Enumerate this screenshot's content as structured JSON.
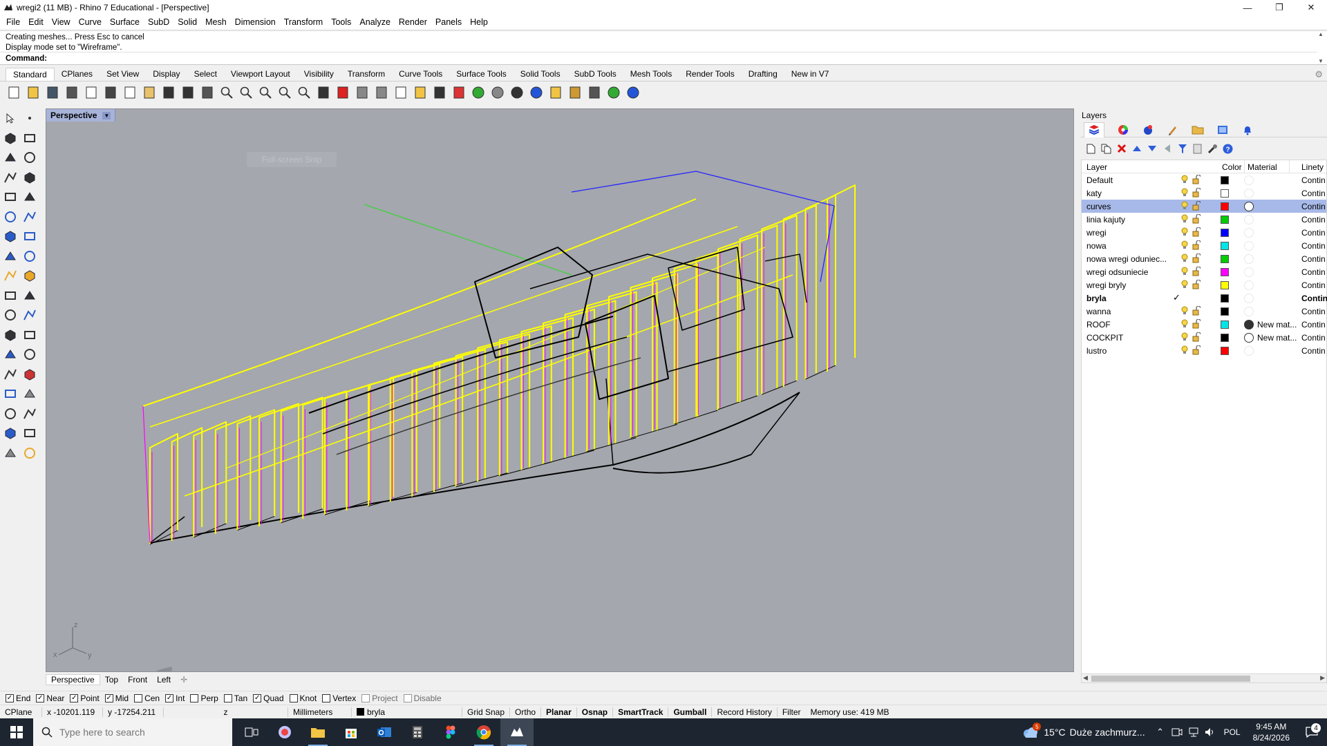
{
  "window": {
    "title": "wregi2 (11 MB) - Rhino 7 Educational - [Perspective]",
    "minimize": "—",
    "maximize": "❐",
    "close": "✕"
  },
  "menu": [
    "File",
    "Edit",
    "View",
    "Curve",
    "Surface",
    "SubD",
    "Solid",
    "Mesh",
    "Dimension",
    "Transform",
    "Tools",
    "Analyze",
    "Render",
    "Panels",
    "Help"
  ],
  "command": {
    "history": [
      "Creating meshes... Press Esc to cancel",
      "Display mode set to \"Wireframe\"."
    ],
    "prompt_label": "Command:",
    "input_value": ""
  },
  "toolbar_tabs": [
    "Standard",
    "CPlanes",
    "Set View",
    "Display",
    "Select",
    "Viewport Layout",
    "Visibility",
    "Transform",
    "Curve Tools",
    "Surface Tools",
    "Solid Tools",
    "SubD Tools",
    "Mesh Tools",
    "Render Tools",
    "Drafting",
    "New in V7"
  ],
  "toolbar_icons": [
    "new-icon",
    "open-icon",
    "save-icon",
    "print-icon",
    "import-icon",
    "cut-icon",
    "copy-icon",
    "paste-icon",
    "undo-icon",
    "pan-icon",
    "rotate-icon",
    "zoom-icon",
    "zoom-window-icon",
    "zoom-extents-icon",
    "zoom-selected-icon",
    "zoom-all-icon",
    "four-views-icon",
    "car-icon",
    "cplane-icon",
    "grid-icon",
    "properties-icon",
    "light-icon",
    "lock-icon",
    "material-icon",
    "color-wheel-icon",
    "shaded-icon",
    "rendered-icon",
    "sphere-icon",
    "filter-icon",
    "settings-icon",
    "dimension-icon",
    "globe-icon",
    "help-icon"
  ],
  "viewport": {
    "label": "Perspective",
    "snip_hint": "Full-screen Snip",
    "axis_z": "z",
    "axis_x": "x",
    "axis_y": "y"
  },
  "viewport_tabs": [
    "Perspective",
    "Top",
    "Front",
    "Left"
  ],
  "layers_panel": {
    "title": "Layers",
    "columns": {
      "layer": "Layer",
      "color": "Color",
      "material": "Material",
      "linetype": "Linety"
    },
    "rows": [
      {
        "name": "Default",
        "color": "#000000",
        "material": "",
        "material_swatch": "",
        "linetype": "Contin",
        "current": false,
        "selected": false
      },
      {
        "name": "katy",
        "color": "#ffffff",
        "material": "",
        "material_swatch": "",
        "linetype": "Contin",
        "current": false,
        "selected": false
      },
      {
        "name": "curves",
        "color": "#ff0000",
        "material": "",
        "material_swatch": "#ffffff",
        "linetype": "Contin",
        "current": false,
        "selected": true
      },
      {
        "name": "linia kajuty",
        "color": "#00cc00",
        "material": "",
        "material_swatch": "",
        "linetype": "Contin",
        "current": false,
        "selected": false
      },
      {
        "name": "wregi",
        "color": "#0000ff",
        "material": "",
        "material_swatch": "",
        "linetype": "Contin",
        "current": false,
        "selected": false
      },
      {
        "name": "nowa",
        "color": "#00e5e5",
        "material": "",
        "material_swatch": "",
        "linetype": "Contin",
        "current": false,
        "selected": false
      },
      {
        "name": "nowa wregi oduniec...",
        "color": "#00cc00",
        "material": "",
        "material_swatch": "",
        "linetype": "Contin",
        "current": false,
        "selected": false
      },
      {
        "name": "wregi odsuniecie",
        "color": "#ff00ff",
        "material": "",
        "material_swatch": "",
        "linetype": "Contin",
        "current": false,
        "selected": false
      },
      {
        "name": "wregi bryly",
        "color": "#ffff00",
        "material": "",
        "material_swatch": "",
        "linetype": "Contin",
        "current": false,
        "selected": false
      },
      {
        "name": "bryla",
        "color": "#000000",
        "material": "",
        "material_swatch": "",
        "linetype": "Contin",
        "current": true,
        "selected": false
      },
      {
        "name": "wanna",
        "color": "#000000",
        "material": "",
        "material_swatch": "",
        "linetype": "Contin",
        "current": false,
        "selected": false
      },
      {
        "name": "ROOF",
        "color": "#00e5e5",
        "material": "New mat...",
        "material_swatch": "#333333",
        "linetype": "Contin",
        "current": false,
        "selected": false
      },
      {
        "name": "COCKPIT",
        "color": "#000000",
        "material": "New mat...",
        "material_swatch": "#ffffff",
        "linetype": "Contin",
        "current": false,
        "selected": false
      },
      {
        "name": "lustro",
        "color": "#ff0000",
        "material": "",
        "material_swatch": "",
        "linetype": "Contin",
        "current": false,
        "selected": false
      }
    ]
  },
  "osnaps": [
    {
      "label": "End",
      "checked": true
    },
    {
      "label": "Near",
      "checked": true
    },
    {
      "label": "Point",
      "checked": true
    },
    {
      "label": "Mid",
      "checked": true
    },
    {
      "label": "Cen",
      "checked": false
    },
    {
      "label": "Int",
      "checked": true
    },
    {
      "label": "Perp",
      "checked": false
    },
    {
      "label": "Tan",
      "checked": false
    },
    {
      "label": "Quad",
      "checked": true
    },
    {
      "label": "Knot",
      "checked": false
    },
    {
      "label": "Vertex",
      "checked": false
    },
    {
      "label": "Project",
      "checked": false,
      "disabled": true
    },
    {
      "label": "Disable",
      "checked": false,
      "disabled": true
    }
  ],
  "status": {
    "cplane": "CPlane",
    "x": "x -10201.119",
    "y": "y -17254.211",
    "z": "z",
    "units": "Millimeters",
    "layer": "bryla",
    "toggles": [
      {
        "label": "Grid Snap",
        "bold": false
      },
      {
        "label": "Ortho",
        "bold": false
      },
      {
        "label": "Planar",
        "bold": true
      },
      {
        "label": "Osnap",
        "bold": true
      },
      {
        "label": "SmartTrack",
        "bold": true
      },
      {
        "label": "Gumball",
        "bold": true
      },
      {
        "label": "Record History",
        "bold": false
      },
      {
        "label": "Filter",
        "bold": false
      }
    ],
    "memory": "Memory use: 419 MB"
  },
  "taskbar": {
    "search_placeholder": "Type here to search",
    "weather_temp": "15°C",
    "weather_desc": "Duże zachmurz...",
    "lang": "POL",
    "time": "9:45 AM",
    "date": "8/24/2026",
    "notif_count": "4",
    "weather_badge": "5"
  }
}
